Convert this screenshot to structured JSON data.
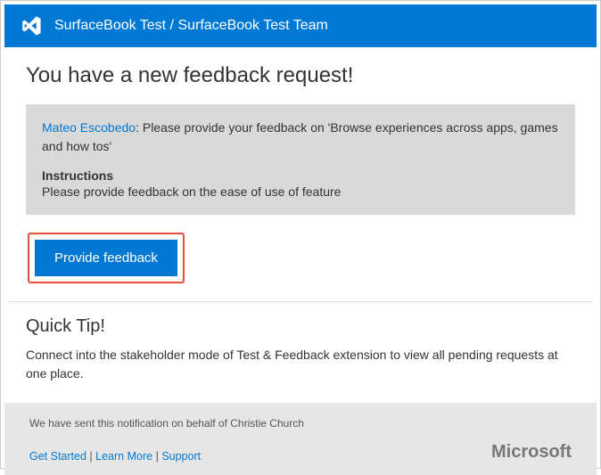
{
  "header": {
    "title": "SurfaceBook Test / SurfaceBook Test Team"
  },
  "main": {
    "heading": "You have a new feedback request!",
    "requester": "Mateo Escobedo",
    "request_separator": ": ",
    "request_text": "Please provide your feedback on 'Browse experiences across  apps, games and how tos'",
    "instructions_label": "Instructions",
    "instructions_text": "Please provide feedback on the ease of use of feature",
    "button_label": "Provide feedback"
  },
  "tip": {
    "heading": "Quick Tip!",
    "text": "Connect into the stakeholder mode of Test & Feedback extension to view all pending requests at one place."
  },
  "footer": {
    "notify_prefix": "We have sent this notification on behalf of  ",
    "notify_name": "Christie Church",
    "links": {
      "get_started": "Get Started",
      "learn_more": "Learn More",
      "support": "Support"
    },
    "brand": "Microsoft"
  }
}
